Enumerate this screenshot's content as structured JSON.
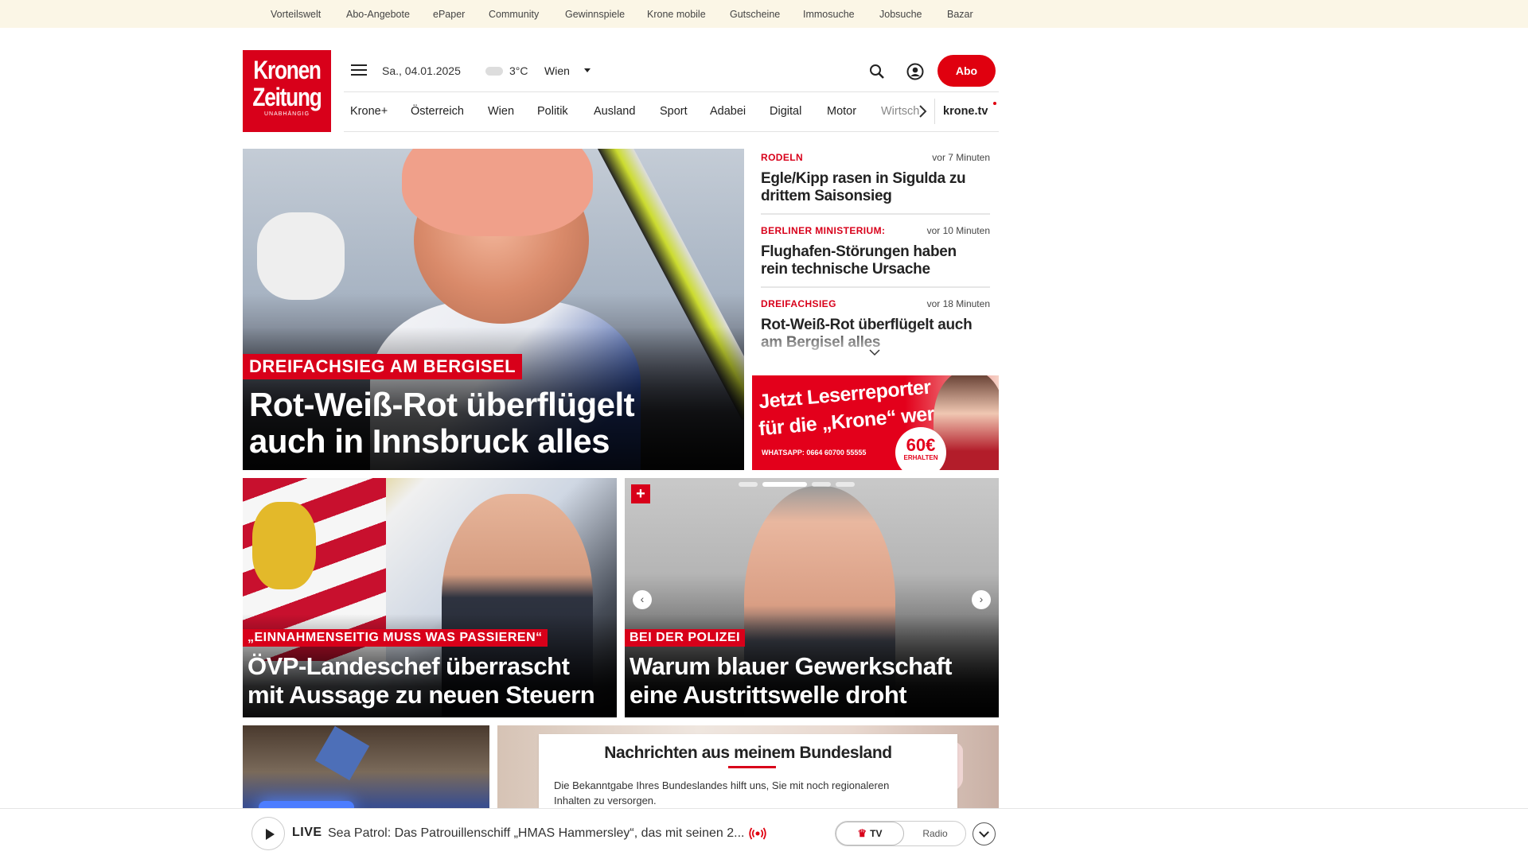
{
  "topbar": {
    "links": [
      "Vorteilswelt",
      "Abo-Angebote",
      "ePaper",
      "Community",
      "Gewinnspiele",
      "Krone mobile",
      "Gutscheine",
      "Immosuche",
      "Jobsuche",
      "Bazar"
    ]
  },
  "logo": {
    "line1": "Kronen",
    "line2": "Zeitung",
    "line3": "UNABHÄNGIG"
  },
  "header": {
    "date": "Sa., 04.01.2025",
    "temperature": "3°C",
    "city": "Wien",
    "abo_label": "Abo"
  },
  "nav": {
    "items": [
      "Krone+",
      "Österreich",
      "Wien",
      "Politik",
      "Ausland",
      "Sport",
      "Adabei",
      "Digital",
      "Motor",
      "Wirtsch"
    ],
    "krone_tv": "krone.tv"
  },
  "hero": {
    "kicker": "DREIFACHSIEG AM BERGISEL",
    "headline_line1": "Rot-Weiß-Rot überflügelt",
    "headline_line2": "auch in Innsbruck alles"
  },
  "ticker": [
    {
      "kicker": "RODELN",
      "time": "vor 7 Minuten",
      "title": "Egle/Kipp rasen in Sigulda zu drittem Saisonsieg"
    },
    {
      "kicker": "BERLINER MINISTERIUM:",
      "time": "vor 10 Minuten",
      "title": "Flughafen-Störungen haben rein technische Ursache"
    },
    {
      "kicker": "DREIFACHSIEG",
      "time": "vor 18 Minuten",
      "title": "Rot-Weiß-Rot überflügelt auch am Bergisel alles"
    }
  ],
  "ad": {
    "line1": "Jetzt Leserreporter",
    "line2": "für die „Krone“ werden",
    "whatsapp": "WHATSAPP: 0664 60700 55555",
    "badge_amount": "60€",
    "badge_text": "ERHALTEN"
  },
  "cards": [
    {
      "kicker": "„EINNAHMENSEITIG MUSS WAS PASSIEREN“",
      "line1": "ÖVP-Landeschef überrascht",
      "line2": "mit Aussage zu neuen Steuern"
    },
    {
      "kicker": "BEI DER POLIZEI",
      "line1": "Warum blauer Gewerkschaft",
      "line2": "eine Austrittswelle droht"
    }
  ],
  "bundesland": {
    "title": "Nachrichten aus meinem Bundesland",
    "text": "Die Bekanntgabe Ihres Bundeslandes hilft uns, Sie mit noch regionaleren Inhalten zu versorgen."
  },
  "player": {
    "live_label": "LIVE",
    "title": "Sea Patrol: Das Patrouillenschiff „HMAS Hammersley“, das mit seinen 2...",
    "tv_label": "TV",
    "radio_label": "Radio"
  },
  "colors": {
    "brand_red": "#d8001a",
    "topbar_bg": "#fbf6e6"
  }
}
